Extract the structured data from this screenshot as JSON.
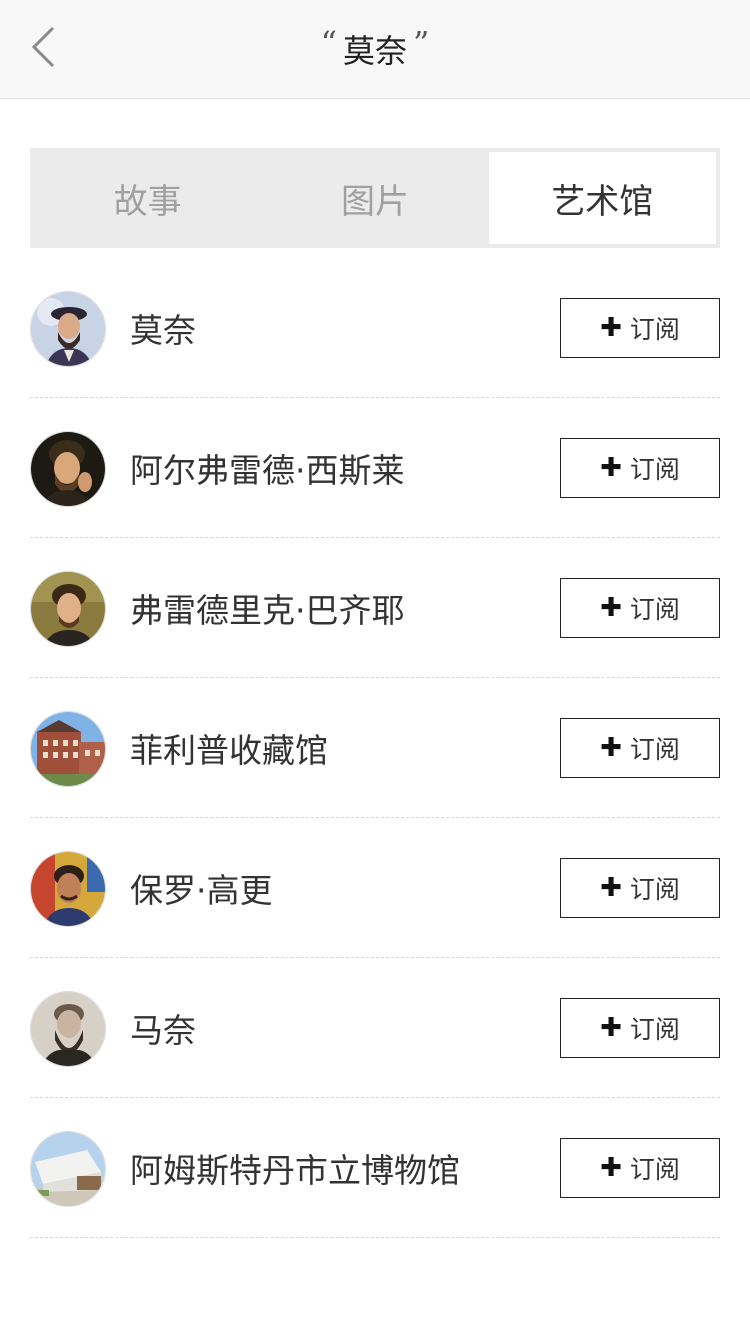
{
  "header": {
    "open_quote": "“",
    "title": "莫奈",
    "close_quote": "”",
    "back_icon": "chevron-left-icon"
  },
  "tabs": [
    {
      "label": "故事",
      "active": false
    },
    {
      "label": "图片",
      "active": false
    },
    {
      "label": "艺术馆",
      "active": true
    }
  ],
  "list": {
    "items": [
      {
        "name": "莫奈",
        "button": "订阅",
        "button_icon": "plus-icon",
        "avatar": "monet-portrait"
      },
      {
        "name": "阿尔弗雷德·西斯莱",
        "button": "订阅",
        "button_icon": "plus-icon",
        "avatar": "sisley-portrait"
      },
      {
        "name": "弗雷德里克·巴齐耶",
        "button": "订阅",
        "button_icon": "plus-icon",
        "avatar": "bazille-portrait"
      },
      {
        "name": "菲利普收藏馆",
        "button": "订阅",
        "button_icon": "plus-icon",
        "avatar": "phillips-collection-building"
      },
      {
        "name": "保罗·高更",
        "button": "订阅",
        "button_icon": "plus-icon",
        "avatar": "gauguin-portrait"
      },
      {
        "name": "马奈",
        "button": "订阅",
        "button_icon": "plus-icon",
        "avatar": "manet-portrait"
      },
      {
        "name": "阿姆斯特丹市立博物馆",
        "button": "订阅",
        "button_icon": "plus-icon",
        "avatar": "stedelijk-museum-building"
      }
    ]
  }
}
